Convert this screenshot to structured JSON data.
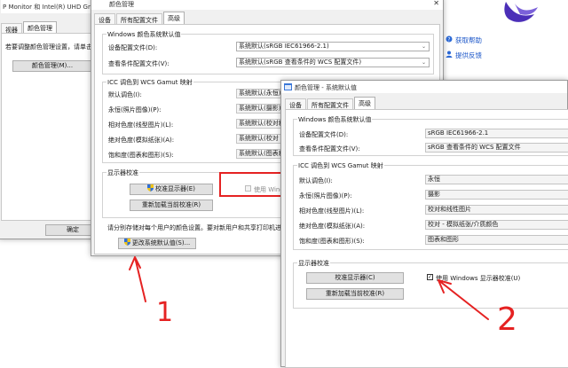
{
  "behind_window": {
    "title": "P Monitor 和 Intel(R) UHD Graphi",
    "tabs": [
      "视器",
      "颜色管理"
    ],
    "description": "若要调整颜色管理设置，请单击\"颜",
    "color_mgmt_button": "颜色管理(M)...",
    "ok_button": "确定"
  },
  "help_panel": {
    "links": [
      "获取帮助",
      "提供反馈"
    ],
    "colors": {
      "link": "#1a55c8"
    }
  },
  "mid_window": {
    "title": "颜色管理",
    "tabs": [
      "设备",
      "所有配置文件",
      "高级"
    ],
    "windows_group": {
      "title": "Windows 颜色系统默认值",
      "rows": [
        {
          "label": "设备配置文件(D):",
          "value": "系统默认(sRGB IEC61966-2.1)"
        },
        {
          "label": "查看条件配置文件(V):",
          "value": "系统默认(sRGB 查看条件的 WCS 配置文件)"
        }
      ]
    },
    "icc_group": {
      "title": "ICC 调色到 WCS Gamut 映射",
      "rows": [
        {
          "label": "默认调色(I):",
          "value": "系统默认(永恒)"
        },
        {
          "label": "永恒(照片图像)(P):",
          "value": "系统默认(摄影)"
        },
        {
          "label": "相对色度(线型图片)(L):",
          "value": "系统默认(校对和线"
        },
        {
          "label": "绝对色度(模拟纸张)(A):",
          "value": "系统默认(校对 - 模"
        },
        {
          "label": "饱和度(图表和图形)(S):",
          "value": "系统默认(图表和图"
        }
      ]
    },
    "calibration_group": {
      "title": "显示器校准",
      "calibrate_button": "校准显示器(E)",
      "reload_button": "重新加载当前校准(R)",
      "checkbox_label": "使用 Window"
    },
    "note": "请分别存储对每个用户的颜色设置。要对新用户和共享打印机进行更改",
    "change_defaults_button": "更改系统默认值(S)..."
  },
  "front_window": {
    "title": "颜色管理 - 系统默认值",
    "tabs": [
      "设备",
      "所有配置文件",
      "高级"
    ],
    "windows_group": {
      "title": "Windows 颜色系统默认值",
      "rows": [
        {
          "label": "设备配置文件(D):",
          "value": "sRGB IEC61966-2.1"
        },
        {
          "label": "查看条件配置文件(V):",
          "value": "sRGB 查看条件的 WCS 配置文件"
        }
      ]
    },
    "icc_group": {
      "title": "ICC 调色到 WCS Gamut 映射",
      "rows": [
        {
          "label": "默认调色(I):",
          "value": "永恒"
        },
        {
          "label": "永恒(照片图像)(P):",
          "value": "摄影"
        },
        {
          "label": "相对色度(线型图片)(L):",
          "value": "校对和线性图片"
        },
        {
          "label": "绝对色度(模拟纸张)(A):",
          "value": "校对 - 模拟纸张/介质颜色"
        },
        {
          "label": "饱和度(图表和图形)(S):",
          "value": "图表和图形"
        }
      ]
    },
    "calibration_group": {
      "title": "显示器校准",
      "calibrate_button": "校准显示器(C)",
      "reload_button": "重新加载当前校准(R)",
      "checkbox_label": "使用 Windows 显示器校准(U)",
      "checkbox_checked": true
    }
  },
  "annotations": {
    "marks": [
      "1",
      "2"
    ],
    "color": "#e52222"
  },
  "icons": [
    "uac-shield-icon",
    "app-bird-logo-icon",
    "help-circle-icon",
    "feedback-person-icon",
    "dropdown-chevron-icon",
    "window-icon"
  ]
}
